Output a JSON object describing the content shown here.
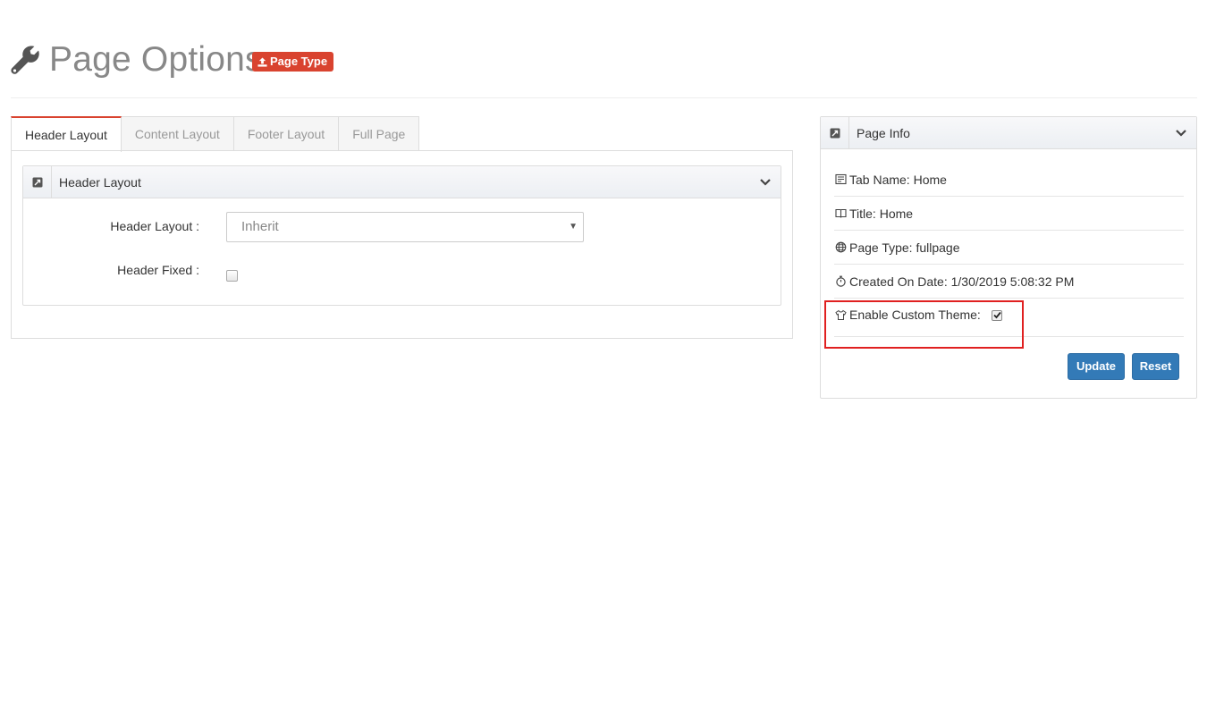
{
  "header": {
    "title": "Page Options",
    "badge_label": "Page Type"
  },
  "tabs": [
    {
      "label": "Header Layout",
      "active": true
    },
    {
      "label": "Content Layout",
      "active": false
    },
    {
      "label": "Footer Layout",
      "active": false
    },
    {
      "label": "Full Page",
      "active": false
    }
  ],
  "header_layout_panel": {
    "title": "Header Layout",
    "layout_label": "Header Layout :",
    "layout_value": "Inherit",
    "fixed_label": "Header Fixed :",
    "fixed_checked": false
  },
  "page_info": {
    "title": "Page Info",
    "tab_name": "Tab Name: Home",
    "page_title": "Title: Home",
    "page_type": "Page Type: fullpage",
    "created": "Created On Date: 1/30/2019 5:08:32 PM",
    "custom_theme_label": "Enable Custom Theme:",
    "custom_theme_checked": true,
    "update_label": "Update",
    "reset_label": "Reset"
  },
  "colors": {
    "accent_red": "#d9432f",
    "primary_blue": "#337ab7",
    "highlight_red": "#e02020"
  },
  "icons": [
    "wrench-icon",
    "upload-icon",
    "expand-icon",
    "chevron-down-icon",
    "newspaper-icon",
    "book-icon",
    "globe-icon",
    "stopwatch-icon",
    "shirt-icon",
    "checkmark-icon"
  ]
}
